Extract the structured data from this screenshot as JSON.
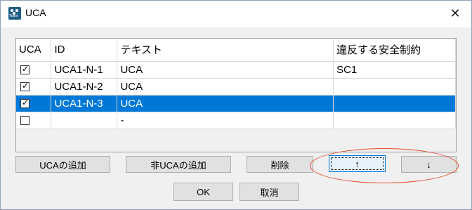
{
  "window": {
    "title": "UCA",
    "close_glyph": "✕",
    "icon_label": "Team"
  },
  "table": {
    "headers": [
      "UCA",
      "ID",
      "テキスト",
      "違反する安全制約"
    ],
    "rows": [
      {
        "checked": true,
        "id": "UCA1-N-1",
        "text": "UCA",
        "violated": "SC1",
        "selected": false
      },
      {
        "checked": true,
        "id": "UCA1-N-2",
        "text": "UCA",
        "violated": "",
        "selected": false
      },
      {
        "checked": true,
        "id": "UCA1-N-3",
        "text": "UCA",
        "violated": "",
        "selected": true
      },
      {
        "checked": false,
        "id": "",
        "text": "-",
        "violated": "",
        "selected": false
      }
    ]
  },
  "buttons": {
    "add_uca": "UCAの追加",
    "add_non_uca": "非UCAの追加",
    "delete": "削除",
    "move_up": "↑",
    "move_down": "↓",
    "ok": "OK",
    "cancel": "取消"
  },
  "colors": {
    "selection": "#0078d7",
    "annotation_oval": "#e24a2a"
  },
  "icons": {
    "app": "app-logo-icon",
    "close": "close-icon",
    "check": "checkmark-icon"
  }
}
